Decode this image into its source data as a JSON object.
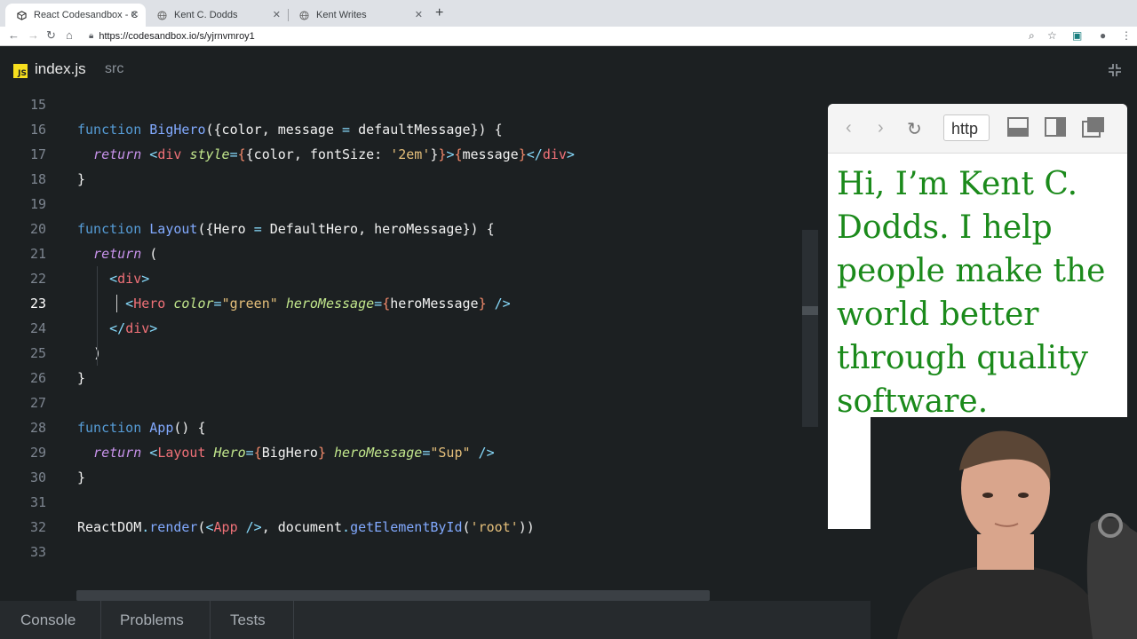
{
  "browser": {
    "tabs": [
      {
        "title": "React Codesandbox - CodeSa",
        "icon": "codesandbox-icon",
        "active": true
      },
      {
        "title": "Kent C. Dodds",
        "icon": "globe-icon",
        "active": false
      },
      {
        "title": "Kent Writes",
        "icon": "globe-icon",
        "active": false
      }
    ],
    "url": "https://codesandbox.io/s/yjrnvmroy1"
  },
  "editor": {
    "filename": "index.js",
    "directory": "src",
    "current_line": 23,
    "lines": [
      {
        "n": "15",
        "tokens": []
      },
      {
        "n": "16",
        "tokens": [
          [
            "kw",
            "function "
          ],
          [
            "fn",
            "BigHero"
          ],
          [
            "p",
            "({color, message "
          ],
          [
            "op",
            "="
          ],
          [
            "p",
            " defaultMessage}) {"
          ]
        ]
      },
      {
        "n": "17",
        "tokens": [
          [
            "it",
            "  return "
          ],
          [
            "op",
            "<"
          ],
          [
            "tag",
            "div "
          ],
          [
            "attr",
            "style"
          ],
          [
            "op",
            "="
          ],
          [
            "brc",
            "{"
          ],
          [
            "p",
            "{color, fontSize: "
          ],
          [
            "str",
            "'2em'"
          ],
          [
            "p",
            "}"
          ],
          [
            "brc",
            "}"
          ],
          [
            "op",
            ">"
          ],
          [
            "brc",
            "{"
          ],
          [
            "p",
            "message"
          ],
          [
            "brc",
            "}"
          ],
          [
            "op",
            "</"
          ],
          [
            "tag",
            "div"
          ],
          [
            "op",
            ">"
          ]
        ]
      },
      {
        "n": "18",
        "tokens": [
          [
            "p",
            "}"
          ]
        ]
      },
      {
        "n": "19",
        "tokens": []
      },
      {
        "n": "20",
        "tokens": [
          [
            "kw",
            "function "
          ],
          [
            "fn",
            "Layout"
          ],
          [
            "p",
            "({Hero "
          ],
          [
            "op",
            "="
          ],
          [
            "p",
            " DefaultHero, heroMessage}) {"
          ]
        ]
      },
      {
        "n": "21",
        "tokens": [
          [
            "it",
            "  return "
          ],
          [
            "p",
            "("
          ]
        ]
      },
      {
        "n": "22",
        "tokens": [
          [
            "op",
            "    <"
          ],
          [
            "tag",
            "div"
          ],
          [
            "op",
            ">"
          ]
        ]
      },
      {
        "n": "23",
        "tokens": [
          [
            "op",
            "      <"
          ],
          [
            "tag",
            "Hero "
          ],
          [
            "attr",
            "color"
          ],
          [
            "op",
            "="
          ],
          [
            "str",
            "\"green\" "
          ],
          [
            "attr",
            "heroMessage"
          ],
          [
            "op",
            "="
          ],
          [
            "brc",
            "{"
          ],
          [
            "p",
            "heroMessage"
          ],
          [
            "brc",
            "}"
          ],
          [
            "op",
            " />"
          ]
        ]
      },
      {
        "n": "24",
        "tokens": [
          [
            "op",
            "    </"
          ],
          [
            "tag",
            "div"
          ],
          [
            "op",
            ">"
          ]
        ]
      },
      {
        "n": "25",
        "tokens": [
          [
            "p",
            "  )"
          ]
        ]
      },
      {
        "n": "26",
        "tokens": [
          [
            "p",
            "}"
          ]
        ]
      },
      {
        "n": "27",
        "tokens": []
      },
      {
        "n": "28",
        "tokens": [
          [
            "kw",
            "function "
          ],
          [
            "fn",
            "App"
          ],
          [
            "p",
            "() {"
          ]
        ]
      },
      {
        "n": "29",
        "tokens": [
          [
            "it",
            "  return "
          ],
          [
            "op",
            "<"
          ],
          [
            "tag",
            "Layout "
          ],
          [
            "attr",
            "Hero"
          ],
          [
            "op",
            "="
          ],
          [
            "brc",
            "{"
          ],
          [
            "p",
            "BigHero"
          ],
          [
            "brc",
            "}"
          ],
          [
            "p",
            " "
          ],
          [
            "attr",
            "heroMessage"
          ],
          [
            "op",
            "="
          ],
          [
            "str",
            "\"Sup\""
          ],
          [
            "op",
            " />"
          ]
        ]
      },
      {
        "n": "30",
        "tokens": [
          [
            "p",
            "}"
          ]
        ]
      },
      {
        "n": "31",
        "tokens": []
      },
      {
        "n": "32",
        "tokens": [
          [
            "p",
            "ReactDOM"
          ],
          [
            "op",
            "."
          ],
          [
            "fn",
            "render"
          ],
          [
            "p",
            "("
          ],
          [
            "op",
            "<"
          ],
          [
            "tag",
            "App "
          ],
          [
            "op",
            "/>"
          ],
          [
            "p",
            ", document"
          ],
          [
            "op",
            "."
          ],
          [
            "fn",
            "getElementById"
          ],
          [
            "p",
            "("
          ],
          [
            "str",
            "'root'"
          ],
          [
            "p",
            "))"
          ]
        ]
      },
      {
        "n": "33",
        "tokens": []
      }
    ]
  },
  "bottom_panel": {
    "tabs": [
      "Console",
      "Problems",
      "Tests"
    ]
  },
  "preview": {
    "url_text": "http",
    "content": "Hi, I’m Kent C. Dodds. I help people make the world better through quality software.",
    "text_color": "#1b8a1b"
  },
  "colors": {
    "editor_bg": "#1c2022",
    "keyword": "#569cd6",
    "function": "#82aaff",
    "string": "#e6c07b",
    "tag": "#f07178"
  }
}
